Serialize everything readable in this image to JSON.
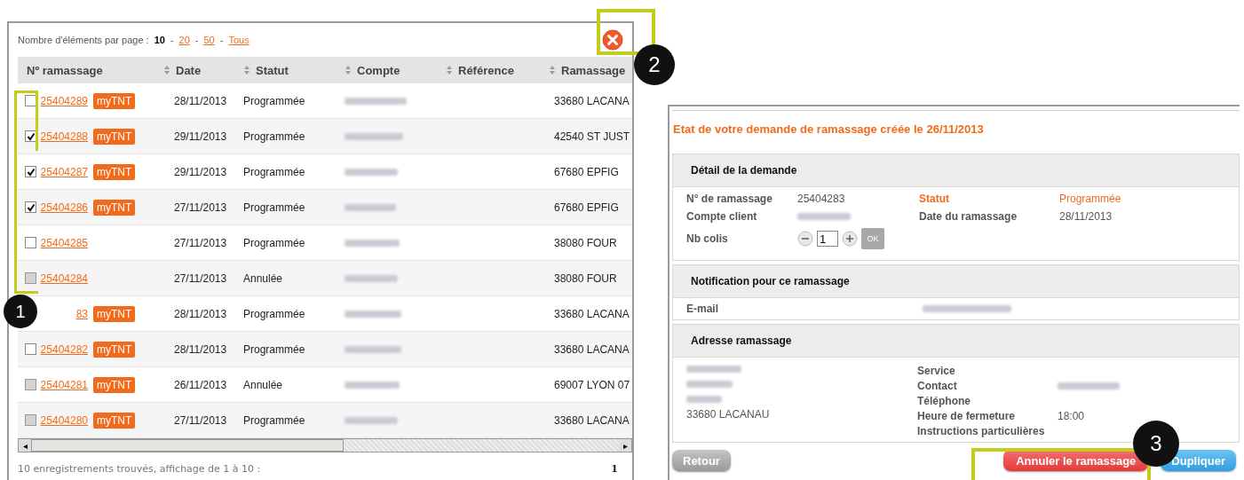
{
  "list_panel": {
    "page_size_label": "Nombre d'éléments par page :",
    "page_sizes": [
      {
        "label": "10",
        "selected": true
      },
      {
        "label": "20",
        "selected": false
      },
      {
        "label": "50",
        "selected": false
      },
      {
        "label": "Tous",
        "selected": false
      }
    ],
    "separator": "-",
    "scroll_left": "◂",
    "scroll_right": "▸",
    "table": {
      "columns": [
        "Nº ramassage",
        "Date",
        "Statut",
        "Compte",
        "Référence",
        "Ramassage"
      ],
      "rows": [
        {
          "checked": false,
          "disabled": false,
          "number": "25404289",
          "badge": "myTNT",
          "date": "28/11/2013",
          "status": "Programmée",
          "pickup": "33680 LACANA"
        },
        {
          "checked": true,
          "disabled": false,
          "number": "25404288",
          "badge": "myTNT",
          "date": "29/11/2013",
          "status": "Programmée",
          "pickup": "42540 ST JUST"
        },
        {
          "checked": true,
          "disabled": false,
          "number": "25404287",
          "badge": "myTNT",
          "date": "29/11/2013",
          "status": "Programmée",
          "pickup": "67680 EPFIG"
        },
        {
          "checked": true,
          "disabled": false,
          "number": "25404286",
          "badge": "myTNT",
          "date": "27/11/2013",
          "status": "Programmée",
          "pickup": "67680 EPFIG"
        },
        {
          "checked": false,
          "disabled": false,
          "number": "25404285",
          "date": "27/11/2013",
          "status": "Programmée",
          "pickup": "38080 FOUR"
        },
        {
          "checked": false,
          "disabled": true,
          "number": "25404284",
          "date": "27/11/2013",
          "status": "Annulée",
          "pickup": "38080 FOUR"
        },
        {
          "number": "83",
          "badge": "myTNT",
          "date": "28/11/2013",
          "status": "Programmée",
          "pickup": "33680 LACANA"
        },
        {
          "checked": false,
          "disabled": false,
          "number": "25404282",
          "badge": "myTNT",
          "date": "28/11/2013",
          "status": "Programmée",
          "pickup": "33680 LACANA"
        },
        {
          "checked": false,
          "disabled": true,
          "number": "25404281",
          "badge": "myTNT",
          "date": "26/11/2013",
          "status": "Annulée",
          "pickup": "69007 LYON 07"
        },
        {
          "checked": false,
          "disabled": true,
          "number": "25404280",
          "badge": "myTNT",
          "date": "27/11/2013",
          "status": "Programmée",
          "pickup": "33680 LACANA"
        }
      ]
    },
    "summary": "10 enregistrements trouvés, affichage de 1 à 10 :",
    "page": "1"
  },
  "detail_panel": {
    "title": "Etat de votre demande de ramassage créée le 26/11/2013",
    "request": {
      "heading": "Détail de la demande",
      "number_label": "N° de ramassage",
      "number": "25404283",
      "status_label": "Statut",
      "status": "Programmée",
      "account_label": "Compte client",
      "date_label": "Date du ramassage",
      "date": "28/11/2013",
      "parcels_label": "Nb colis",
      "parcels": "1",
      "ok": "OK"
    },
    "notification": {
      "heading": "Notification pour ce ramassage",
      "email_label": "E-mail"
    },
    "address": {
      "heading": "Adresse ramassage",
      "city": "33680 LACANAU",
      "fields": [
        {
          "label": "Service"
        },
        {
          "label": "Contact",
          "blurred": true
        },
        {
          "label": "Téléphone"
        },
        {
          "label": "Heure de fermeture",
          "value": "18:00"
        },
        {
          "label": "Instructions particulières"
        }
      ]
    },
    "buttons": {
      "back": "Retour",
      "cancel": "Annuler le ramassage",
      "duplicate": "Dupliquer"
    }
  },
  "callouts": [
    {
      "label": "1"
    },
    {
      "label": "2"
    },
    {
      "label": "3"
    }
  ]
}
